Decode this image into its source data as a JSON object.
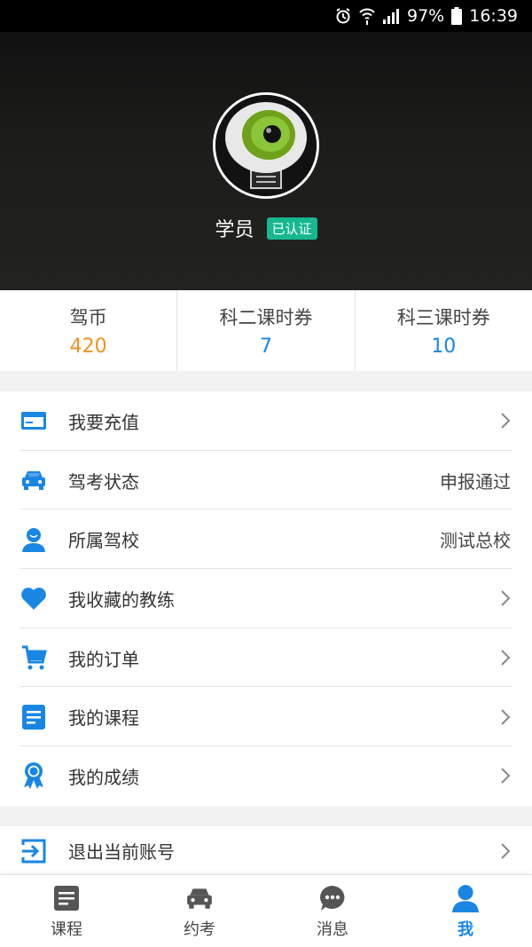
{
  "status_bar": {
    "battery": "97%",
    "time": "16:39"
  },
  "profile": {
    "name": "学员",
    "badge": "已认证"
  },
  "stats": [
    {
      "label": "驾币",
      "value": "420",
      "color": "#f0921c"
    },
    {
      "label": "科二课时券",
      "value": "7",
      "color": "#1a86e4"
    },
    {
      "label": "科三课时券",
      "value": "10",
      "color": "#1a86e4"
    }
  ],
  "menu": [
    {
      "label": "我要充值",
      "icon": "credit-card-icon",
      "value": ""
    },
    {
      "label": "驾考状态",
      "icon": "car-icon",
      "value": "申报通过"
    },
    {
      "label": "所属驾校",
      "icon": "person-icon",
      "value": "测试总校"
    },
    {
      "label": "我收藏的教练",
      "icon": "heart-icon",
      "value": ""
    },
    {
      "label": "我的订单",
      "icon": "cart-icon",
      "value": ""
    },
    {
      "label": "我的课程",
      "icon": "document-icon",
      "value": ""
    },
    {
      "label": "我的成绩",
      "icon": "award-icon",
      "value": ""
    }
  ],
  "logout": {
    "label": "退出当前账号",
    "icon": "logout-icon"
  },
  "bottom_nav": [
    {
      "label": "课程",
      "icon": "document-icon",
      "active": false
    },
    {
      "label": "约考",
      "icon": "car-icon",
      "active": false
    },
    {
      "label": "消息",
      "icon": "chat-icon",
      "active": false
    },
    {
      "label": "我",
      "icon": "person-icon",
      "active": true
    }
  ],
  "colors": {
    "accent": "#1a86e4",
    "orange": "#f0921c",
    "badge": "#16b890"
  }
}
